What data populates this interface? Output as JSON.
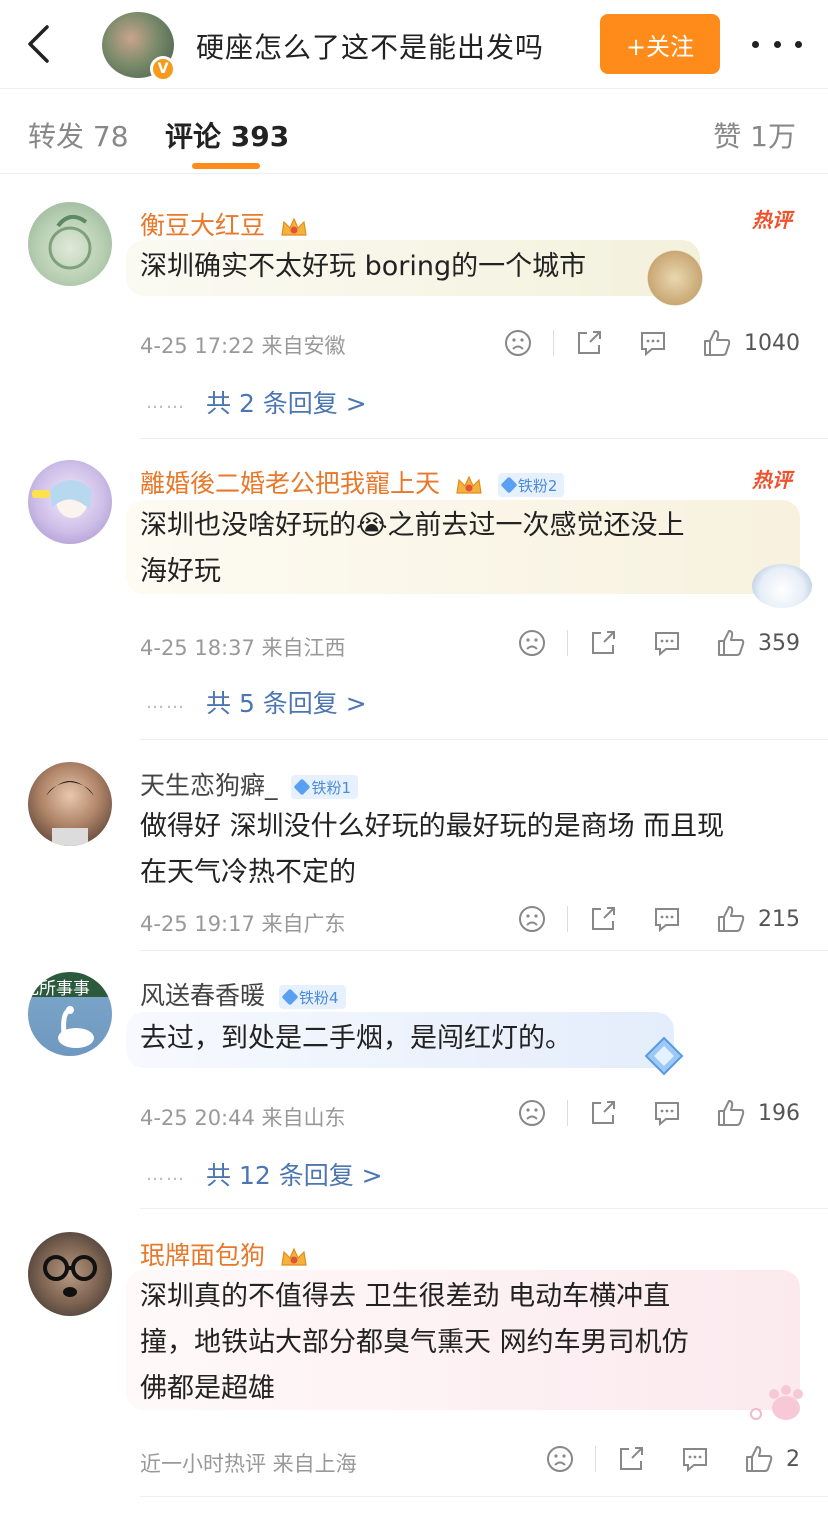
{
  "header": {
    "title": "硬座怎么了这不是能出发吗",
    "follow_label": "+关注",
    "verified_mark": "V"
  },
  "tabs": {
    "repost": "转发 78",
    "comments": "评论 393",
    "likes": "赞 1万"
  },
  "hot_label": "热评",
  "comments": [
    {
      "name": "衡豆大红豆",
      "fan_badge": "",
      "text": "深圳确实不太好玩 boring的一个城市",
      "meta": "4-25 17:22  来自安徽",
      "likes": "1040",
      "replies": "共 2 条回复 >",
      "hot": true
    },
    {
      "name": "離婚後二婚老公把我寵上天",
      "fan_badge": "铁粉2",
      "text_line1": "深圳也没啥好玩的😭之前去过一次感觉还没上",
      "text_line2": "海好玩",
      "meta": "4-25 18:37  来自江西",
      "likes": "359",
      "replies": "共 5 条回复 >",
      "hot": true
    },
    {
      "name": "天生恋狗癖_",
      "fan_badge": "铁粉1",
      "text_line1": "做得好 深圳没什么好玩的最好玩的是商场 而且现",
      "text_line2": "在天气冷热不定的",
      "meta": "4-25 19:17  来自广东",
      "likes": "215"
    },
    {
      "name": "风送春香暖",
      "fan_badge": "铁粉4",
      "avatar_text": "无所事事",
      "text": "去过，到处是二手烟，是闯红灯的。",
      "meta": "4-25 20:44  来自山东",
      "likes": "196",
      "replies": "共 12 条回复 >"
    },
    {
      "name": "珉牌面包狗",
      "fan_badge": "",
      "text_line1": "深圳真的不值得去 卫生很差劲 电动车横冲直",
      "text_line2": "撞，地铁站大部分都臭气熏天 网约车男司机仿",
      "text_line3": "佛都是超雄",
      "meta": "近一小时热评  来自上海",
      "likes": "2"
    }
  ],
  "colors": {
    "accent": "#ff8c1a",
    "name_orange": "#e8782a",
    "link_blue": "#4b76b1",
    "hot_red": "#f0522d"
  },
  "icons": [
    "back-arrow-icon",
    "more-dots-icon",
    "crown-icon",
    "fan-diamond-icon",
    "dislike-face-icon",
    "share-icon",
    "comment-icon",
    "thumbs-up-icon"
  ]
}
